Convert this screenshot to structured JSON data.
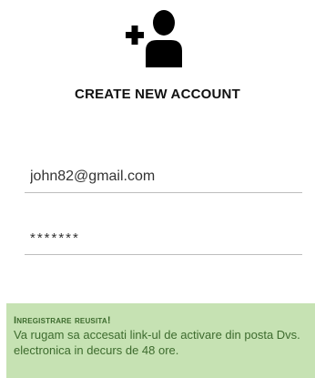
{
  "header": {
    "logo_icon": "add-user-icon",
    "title": "CREATE NEW ACCOUNT"
  },
  "form": {
    "email_value": "john82@gmail.com",
    "password_value": "*******"
  },
  "alert": {
    "title": "Inregistrare reusita!",
    "message": "Va rugam sa accesati link-ul de activare din posta Dvs. electronica in decurs de 48 ore.",
    "background": "#c6e2b3",
    "text_color": "#3d6b2e"
  }
}
